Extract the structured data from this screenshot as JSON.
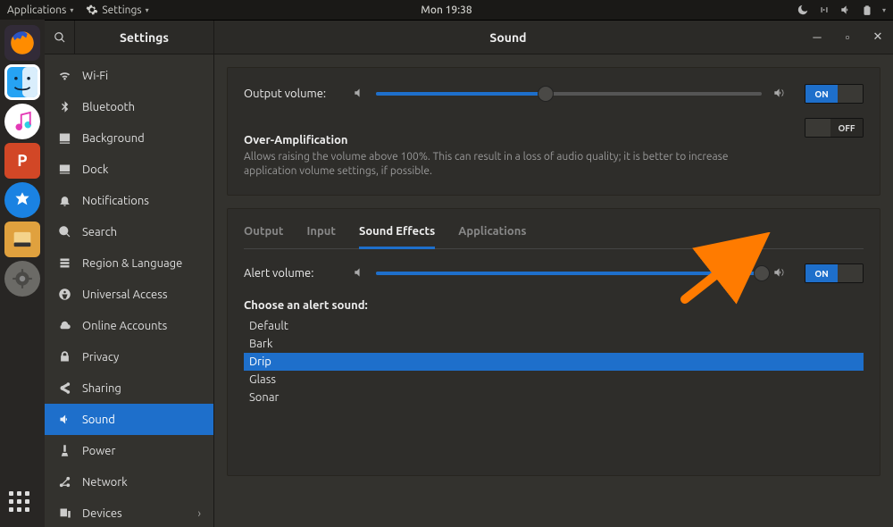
{
  "topbar": {
    "apps_label": "Applications",
    "active_app": "Settings",
    "clock": "Mon 19:38"
  },
  "dock": {
    "items": [
      {
        "name": "firefox",
        "color": "#ff8c00"
      },
      {
        "name": "finder",
        "color": "#1b8fe3"
      },
      {
        "name": "music",
        "color": "#f8f8f8"
      },
      {
        "name": "powerpoint",
        "color": "#d24726"
      },
      {
        "name": "app-store",
        "color": "#1a82e2"
      },
      {
        "name": "drive",
        "color": "#e0a13e"
      },
      {
        "name": "settings",
        "color": "#6b6a66"
      }
    ]
  },
  "window": {
    "sidebar_title": "Settings",
    "title": "Sound"
  },
  "sidebar": {
    "items": [
      {
        "label": "Wi-Fi",
        "icon": "wifi"
      },
      {
        "label": "Bluetooth",
        "icon": "bluetooth"
      },
      {
        "label": "Background",
        "icon": "background"
      },
      {
        "label": "Dock",
        "icon": "dock"
      },
      {
        "label": "Notifications",
        "icon": "bell"
      },
      {
        "label": "Search",
        "icon": "search"
      },
      {
        "label": "Region & Language",
        "icon": "globe"
      },
      {
        "label": "Universal Access",
        "icon": "access"
      },
      {
        "label": "Online Accounts",
        "icon": "cloud"
      },
      {
        "label": "Privacy",
        "icon": "lock"
      },
      {
        "label": "Sharing",
        "icon": "share"
      },
      {
        "label": "Sound",
        "icon": "sound",
        "selected": true
      },
      {
        "label": "Power",
        "icon": "power"
      },
      {
        "label": "Network",
        "icon": "network"
      },
      {
        "label": "Devices",
        "icon": "devices",
        "has_sub": true
      }
    ]
  },
  "output": {
    "label": "Output volume:",
    "level_pct": 44,
    "toggle": "ON",
    "overamp_title": "Over-Amplification",
    "overamp_desc": "Allows raising the volume above 100%. This can result in a loss of audio quality; it is better to increase application volume settings, if possible.",
    "overamp_toggle": "OFF"
  },
  "tabs": {
    "items": [
      {
        "label": "Output"
      },
      {
        "label": "Input"
      },
      {
        "label": "Sound Effects",
        "active": true
      },
      {
        "label": "Applications"
      }
    ]
  },
  "alert": {
    "label": "Alert volume:",
    "level_pct": 100,
    "toggle": "ON",
    "heading": "Choose an alert sound:",
    "sounds": [
      {
        "label": "Default"
      },
      {
        "label": "Bark"
      },
      {
        "label": "Drip",
        "selected": true
      },
      {
        "label": "Glass"
      },
      {
        "label": "Sonar"
      }
    ]
  },
  "colors": {
    "accent": "#1e6fcb"
  }
}
